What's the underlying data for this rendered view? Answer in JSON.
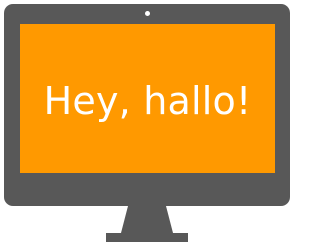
{
  "screen": {
    "message": "Hey, hallo!"
  },
  "colors": {
    "frame": "#585858",
    "screen_background": "#ff9900",
    "text": "#ffffff",
    "webcam": "#ffffff"
  },
  "icons": {
    "device": "desktop-monitor-icon",
    "camera": "webcam-dot"
  }
}
